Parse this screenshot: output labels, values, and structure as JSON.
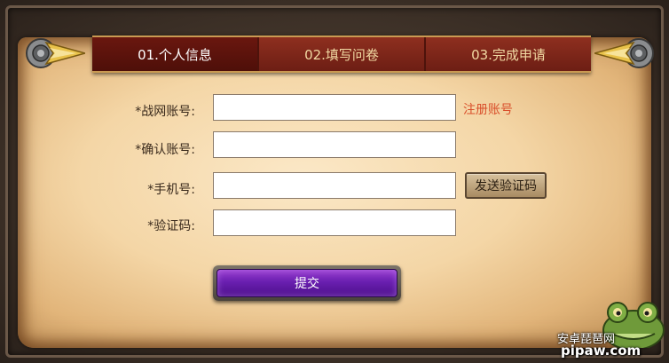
{
  "tabs": [
    {
      "label": "01.个人信息",
      "active": true
    },
    {
      "label": "02.填写问卷",
      "active": false
    },
    {
      "label": "03.完成申请",
      "active": false
    }
  ],
  "form": {
    "battlenet_label": "*战网账号:",
    "battlenet_value": "",
    "register_link": "注册账号",
    "confirm_label": "*确认账号:",
    "confirm_value": "",
    "phone_label": "*手机号:",
    "phone_value": "",
    "send_code_button": "发送验证码",
    "code_label": "*验证码:",
    "code_value": "",
    "submit_button": "提交"
  },
  "watermark": {
    "chinese": "安卓琵琶网",
    "english": "pipaw.com"
  },
  "colors": {
    "tab_bar": "#8e2f1f",
    "active_tab": "#4e0f09",
    "link": "#d94f2b",
    "submit": "#6a1fb0",
    "parchment": "#f4d6a6"
  }
}
